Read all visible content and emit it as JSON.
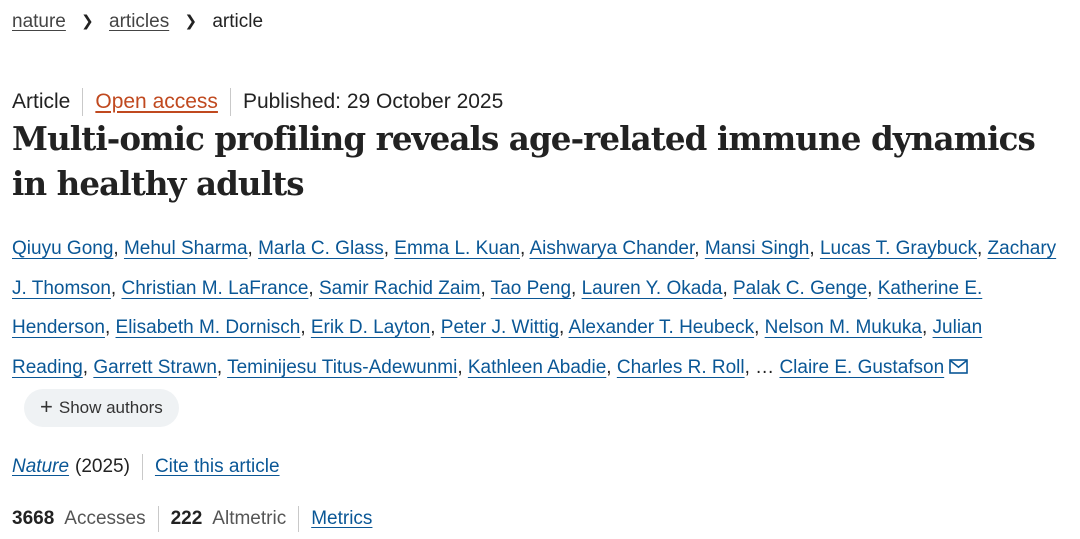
{
  "breadcrumb": {
    "home": "nature",
    "section": "articles",
    "current": "article"
  },
  "article_meta": {
    "type": "Article",
    "access": "Open access",
    "published": "Published: 29 October 2025"
  },
  "title": "Multi-omic profiling reveals age-related immune dynamics in healthy adults",
  "authors": [
    "Qiuyu Gong",
    "Mehul Sharma",
    "Marla C. Glass",
    "Emma L. Kuan",
    "Aishwarya Chander",
    "Mansi Singh",
    "Lucas T. Graybuck",
    "Zachary J. Thomson",
    "Christian M. LaFrance",
    "Samir Rachid Zaim",
    "Tao Peng",
    "Lauren Y. Okada",
    "Palak C. Genge",
    "Katherine E. Henderson",
    "Elisabeth M. Dornisch",
    "Erik D. Layton",
    "Peter J. Wittig",
    "Alexander T. Heubeck",
    "Nelson M. Mukuka",
    "Julian Reading",
    "Garrett Strawn",
    "Teminijesu Titus-Adewunmi",
    "Kathleen Abadie",
    "Charles R. Roll"
  ],
  "authors_ellipsis": "…",
  "last_author": "Claire E. Gustafson",
  "show_authors_label": "Show authors",
  "journal": {
    "name": "Nature",
    "year": "(2025)",
    "cite_label": "Cite this article"
  },
  "stats": {
    "accesses_value": "3668",
    "accesses_label": "Accesses",
    "altmetric_value": "222",
    "altmetric_label": "Altmetric",
    "metrics_label": "Metrics"
  },
  "colors": {
    "link": "#0a5796",
    "open_access": "#c0491f",
    "button_bg": "#eff2f4"
  },
  "icons": {
    "corresponding_author": "mail-icon",
    "expand": "plus-icon",
    "breadcrumb_separator": "chevron-right-icon"
  }
}
